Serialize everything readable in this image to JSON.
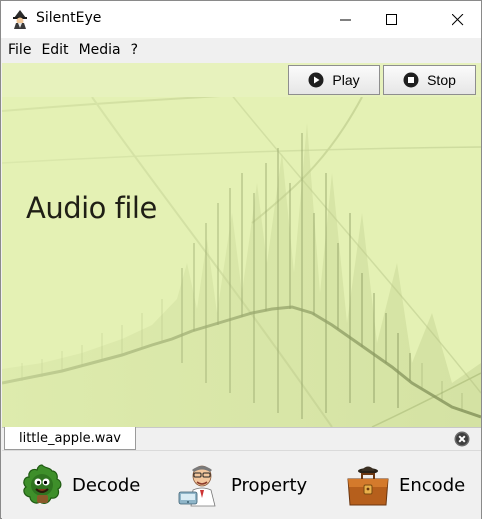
{
  "window": {
    "title": "SilentEye"
  },
  "menu": {
    "items": [
      "File",
      "Edit",
      "Media",
      "?"
    ]
  },
  "media": {
    "label": "Audio file",
    "play_label": "Play",
    "stop_label": "Stop"
  },
  "tabs": {
    "file_name": "little_apple.wav"
  },
  "actions": {
    "decode_label": "Decode",
    "property_label": "Property",
    "encode_label": "Encode"
  },
  "colors": {
    "media_background": "#e4f1b4",
    "waveform": "#7b8a52",
    "close_hover": "#c42b1c"
  },
  "icons": {
    "app": "silenteye-spy-icon",
    "play": "play-circle-icon",
    "stop": "stop-circle-icon",
    "tab_close": "close-circle-icon",
    "decode": "decode-monster-icon",
    "property": "professor-icon",
    "encode": "briefcase-spy-icon"
  }
}
